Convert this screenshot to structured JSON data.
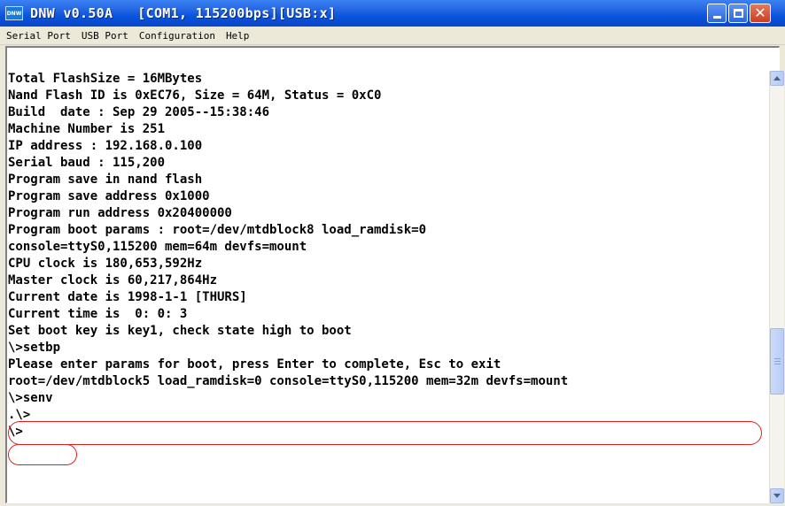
{
  "window": {
    "title": "DNW v0.50A   [COM1, 115200bps][USB:x]"
  },
  "menu": {
    "items": [
      {
        "label": "Serial Port"
      },
      {
        "label": "USB Port"
      },
      {
        "label": "Configuration"
      },
      {
        "label": "Help"
      }
    ]
  },
  "terminal": {
    "lines": [
      "Total FlashSize = 16MBytes",
      "Nand Flash ID is 0xEC76, Size = 64M, Status = 0xC0",
      "Build  date : Sep 29 2005--15:38:46",
      "Machine Number is 251",
      "IP address : 192.168.0.100",
      "Serial baud : 115,200",
      "Program save in nand flash",
      "Program save address 0x1000",
      "Program run address 0x20400000",
      "Program boot params : root=/dev/mtdblock8 load_ramdisk=0",
      "console=ttyS0,115200 mem=64m devfs=mount",
      "CPU clock is 180,653,592Hz",
      "Master clock is 60,217,864Hz",
      "Current date is 1998-1-1 [THURS]",
      "Current time is  0: 0: 3",
      "Set boot key is key1, check state high to boot",
      "\\>setbp",
      "Please enter params for boot, press Enter to complete, Esc to exit",
      "root=/dev/mtdblock5 load_ramdisk=0 console=ttyS0,115200 mem=32m devfs=mount",
      "\\>senv",
      ".\\>",
      "\\>"
    ]
  },
  "icons": {
    "app": "dnw-app-icon",
    "minimize": "minimize-icon",
    "maximize": "maximize-icon",
    "close": "close-icon",
    "scroll_up": "scroll-up-arrow-icon",
    "scroll_down": "scroll-down-arrow-icon"
  },
  "colors": {
    "titlebar": "#0a54dd",
    "highlight": "#e02020",
    "terminal_bg": "#ffffff",
    "text": "#000000"
  }
}
